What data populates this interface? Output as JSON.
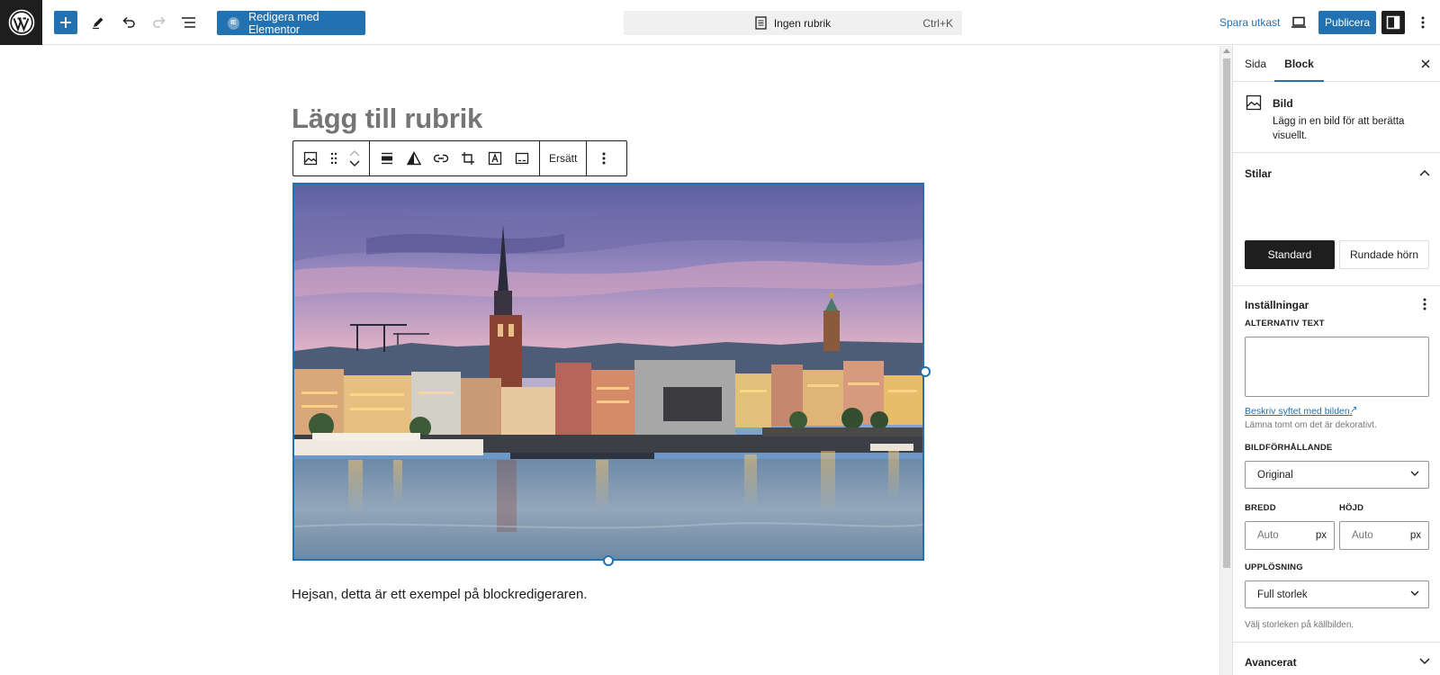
{
  "toolbar": {
    "add_block_icon": "plus-icon",
    "edit_icon": "pencil-icon",
    "undo_icon": "undo-icon",
    "redo_icon": "redo-icon",
    "list_view_icon": "list-view-icon",
    "elementor_label": "Redigera med Elementor",
    "elementor_badge": "IE",
    "document_title": "Ingen rubrik",
    "command_shortcut": "Ctrl+K",
    "save_draft_label": "Spara utkast",
    "preview_icon": "desktop-preview-icon",
    "publish_label": "Publicera",
    "settings_icon": "sidebar-settings-icon",
    "options_icon": "more-vertical-icon"
  },
  "editor": {
    "title_placeholder": "Lägg till rubrik",
    "block_toolbar": {
      "replace_label": "Ersätt"
    },
    "image_alt": "Stockholm Riddarholmen vid solnedgång",
    "paragraph": "Hejsan, detta är ett exempel på blockredigeraren."
  },
  "sidebar": {
    "tabs": [
      {
        "label": "Sida"
      },
      {
        "label": "Block"
      }
    ],
    "active_tab": "Block",
    "block_card": {
      "title": "Bild",
      "description": "Lägg in en bild för att berätta visuellt."
    },
    "styles": {
      "title": "Stilar",
      "options": [
        "Standard",
        "Rundade hörn"
      ],
      "selected": "Standard"
    },
    "settings": {
      "title": "Inställningar",
      "alt_label": "ALTERNATIV TEXT",
      "alt_value": "",
      "alt_help_link": "Beskriv syftet med bilden.",
      "alt_help_text": "Lämna tomt om det är dekorativt.",
      "aspect_label": "BILDFÖRHÅLLANDE",
      "aspect_value": "Original",
      "width_label": "BREDD",
      "height_label": "HÖJD",
      "width_placeholder": "Auto",
      "height_placeholder": "Auto",
      "unit": "px",
      "resolution_label": "UPPLÖSNING",
      "resolution_value": "Full storlek",
      "resolution_help": "Välj storleken på källbilden."
    },
    "advanced": {
      "title": "Avancerat"
    }
  },
  "colors": {
    "accent": "#2271b1",
    "dark": "#1e1e1e",
    "border": "#e0e0e0",
    "muted": "#757575"
  }
}
